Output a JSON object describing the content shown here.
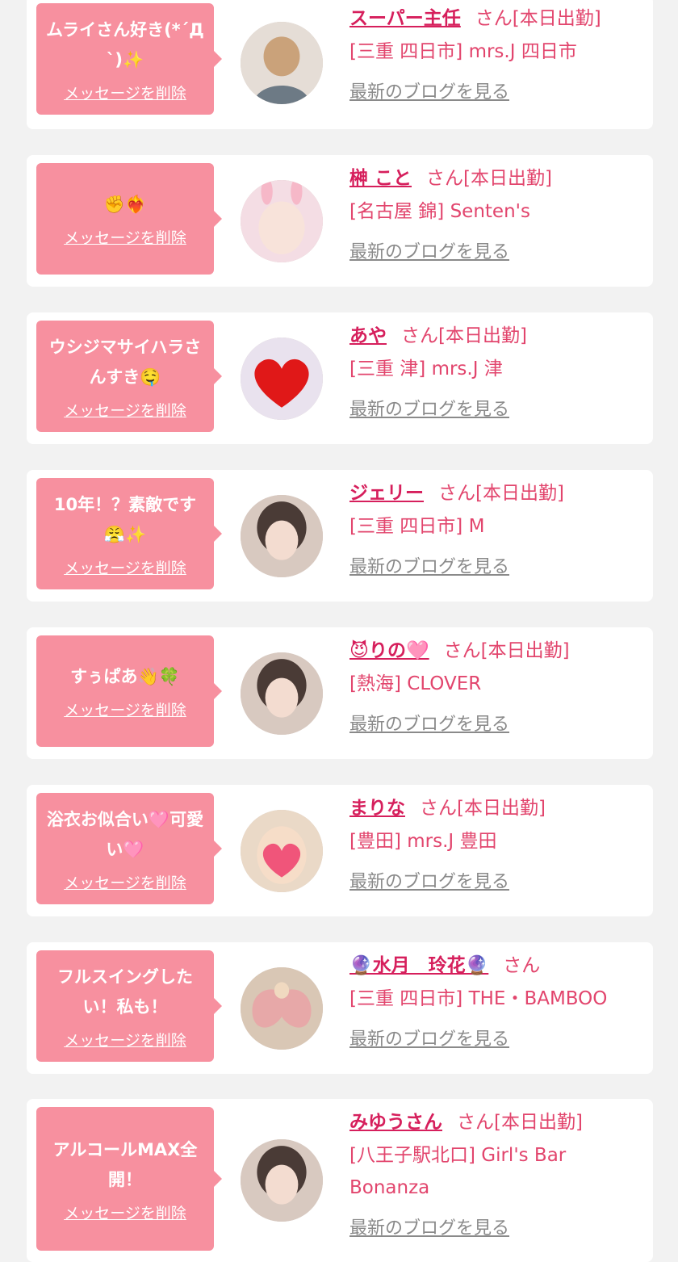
{
  "delete_label": "メッセージを削除",
  "blog_label": "最新のブログを見る",
  "colors": {
    "bubble": "#f7909f",
    "name": "#d61f5c",
    "text": "#e2456d",
    "link_gray": "#8a8a8a",
    "background": "#f2f2f2"
  },
  "messages": [
    {
      "message": "ムライさん好き(*´Д`)✨",
      "name": "スーパー主任",
      "suffix": "さん[本日出勤]",
      "shop": "[三重 四日市] mrs.J 四日市",
      "avatar_icon": "avatar-photo-man"
    },
    {
      "message": "✊❤️‍🔥",
      "name": "榊 こと",
      "suffix": "さん[本日出勤]",
      "shop": "[名古屋 錦] Senten's",
      "avatar_icon": "avatar-photo-bunny"
    },
    {
      "message": "ウシジマサイハラさんすき🤤",
      "name": "あや",
      "suffix": "さん[本日出勤]",
      "shop": "[三重 津] mrs.J 津",
      "avatar_icon": "avatar-photo-heart"
    },
    {
      "message": "10年！？素敵です😤✨",
      "name": "ジェリー",
      "suffix": "さん[本日出勤]",
      "shop": "[三重 四日市] M",
      "avatar_icon": "avatar-photo-girl"
    },
    {
      "message": "すぅぱあ👋🍀",
      "name": "😈りの🩷",
      "suffix": "さん[本日出勤]",
      "shop": "[熱海] CLOVER",
      "avatar_icon": "avatar-photo-girl"
    },
    {
      "message": "浴衣お似合い🩷可愛い🩷",
      "name": "まりな",
      "suffix": "さん[本日出勤]",
      "shop": "[豊田] mrs.J 豊田",
      "avatar_icon": "avatar-photo-heart-face"
    },
    {
      "message": "フルスイングしたい！私も！",
      "name": "🔮水月　玲花🔮",
      "suffix": "さん",
      "shop": "[三重 四日市] THE・BAMBOO",
      "avatar_icon": "avatar-photo-wings"
    },
    {
      "message": "アルコールMAX全開！",
      "name": "みゆうさん",
      "suffix": "さん[本日出勤]",
      "shop": "[八王子駅北口] Girl's Bar Bonanza",
      "avatar_icon": "avatar-photo-girl"
    }
  ]
}
